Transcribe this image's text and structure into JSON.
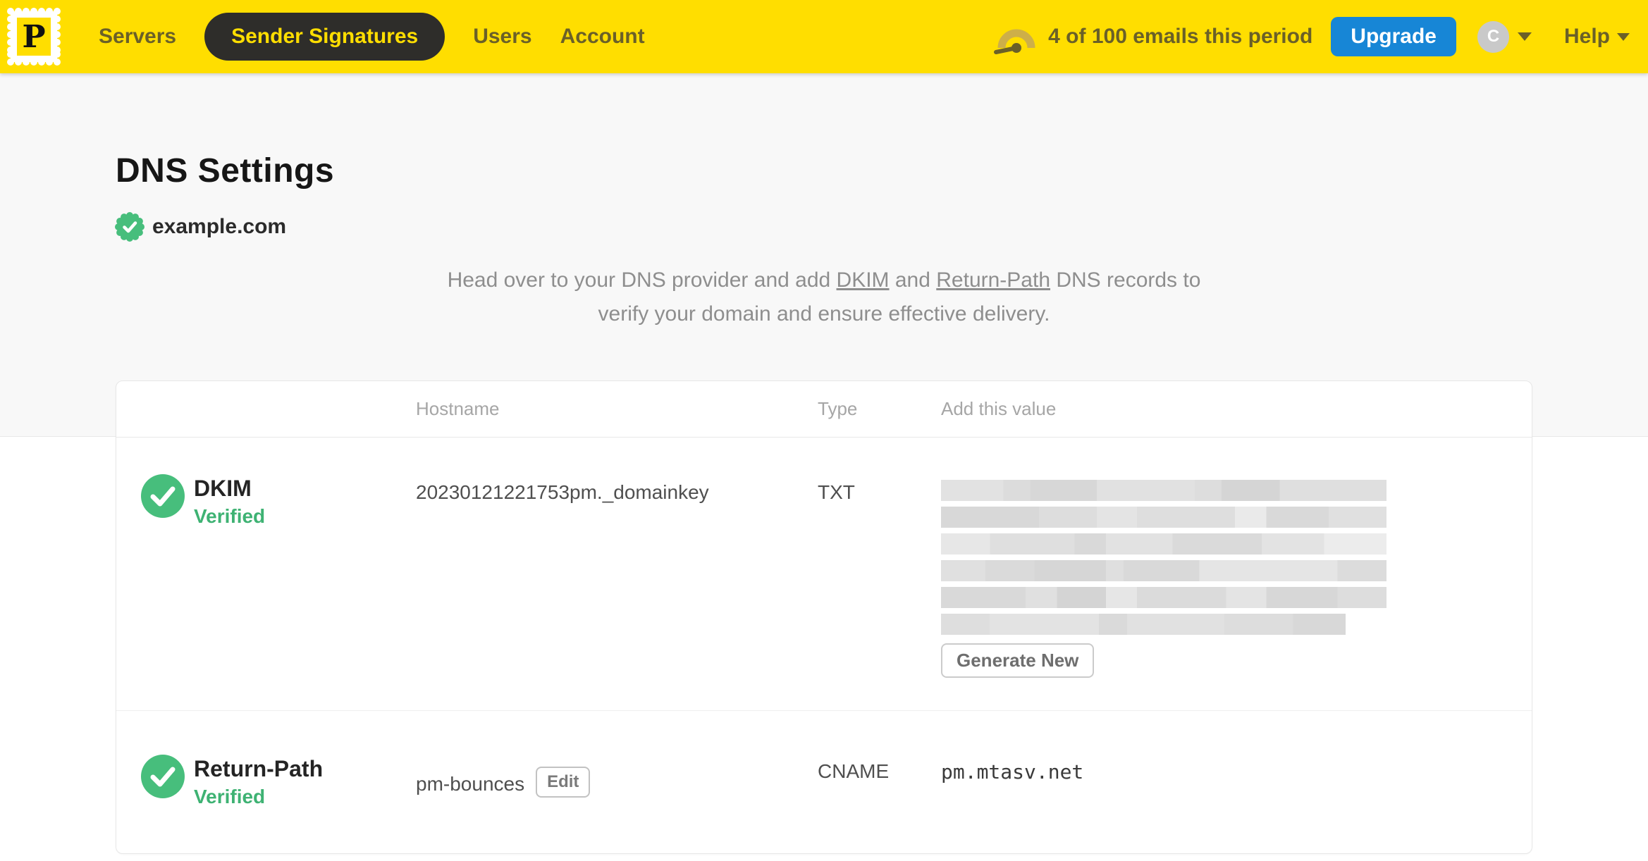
{
  "nav": {
    "logo_letter": "P",
    "items": [
      {
        "label": "Servers",
        "active": false
      },
      {
        "label": "Sender Signatures",
        "active": true
      },
      {
        "label": "Users",
        "active": false
      },
      {
        "label": "Account",
        "active": false
      }
    ],
    "usage_text": "4 of 100 emails this period",
    "upgrade_label": "Upgrade",
    "avatar_initial": "C",
    "help_label": "Help"
  },
  "page": {
    "title": "DNS Settings",
    "domain": "example.com",
    "description": {
      "pre": "Head over to your DNS provider and add ",
      "dkim_link": "DKIM",
      "between": " and ",
      "return_path_link": "Return-Path",
      "post": " DNS records to",
      "line2": "verify your domain and ensure effective delivery."
    }
  },
  "table": {
    "headers": {
      "hostname": "Hostname",
      "type": "Type",
      "value": "Add this value"
    },
    "rows": [
      {
        "name": "DKIM",
        "status": "Verified",
        "hostname": "20230121221753pm._domainkey",
        "type": "TXT",
        "value_redacted": true,
        "redacted_lines": 6,
        "action_label": "Generate New"
      },
      {
        "name": "Return-Path",
        "status": "Verified",
        "hostname": "pm-bounces",
        "edit_label": "Edit",
        "type": "CNAME",
        "value": "pm.mtasv.net"
      }
    ]
  },
  "icons": {
    "logo": "postage-stamp-icon",
    "usage": "gauge-icon",
    "domain_badge": "verified-seal-icon",
    "row_status": "check-circle-icon",
    "dropdowns": "chevron-down-icon"
  },
  "colors": {
    "brand_yellow": "#FFDE00",
    "nav_text": "#6A6028",
    "active_pill_bg": "#2E2D2A",
    "upgrade_blue": "#1786D6",
    "success_green": "#47BE7C",
    "verified_text_green": "#3EB273",
    "page_bg_top": "#F8F8F8",
    "muted_text": "#8E8E8E"
  }
}
